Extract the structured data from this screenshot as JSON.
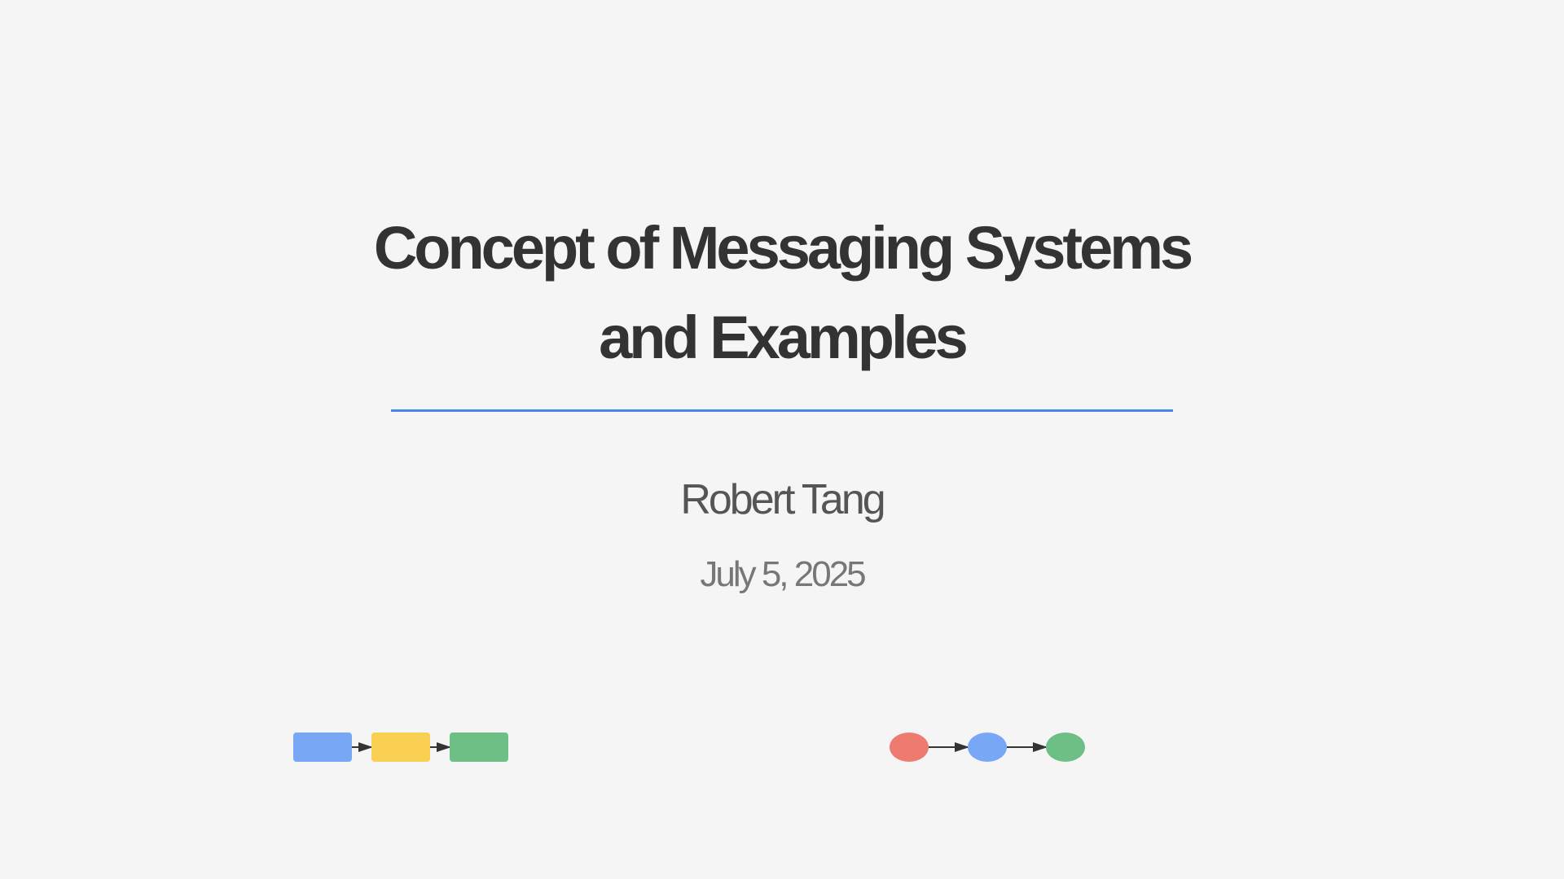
{
  "slide": {
    "title_line1": "Concept of Messaging Systems",
    "title_line2": "and Examples",
    "author": "Robert Tang",
    "date": "July 5, 2025"
  },
  "colors": {
    "background": "#f5f5f5",
    "title": "#333333",
    "divider": "#4a86e8",
    "blue": "#78a8f5",
    "yellow": "#fad053",
    "green": "#6dbf86",
    "red": "#ee7b70"
  },
  "decorations": {
    "left_flow": {
      "shape": "rounded-rectangle",
      "nodes": [
        "blue",
        "yellow",
        "green"
      ]
    },
    "right_flow": {
      "shape": "circle",
      "nodes": [
        "red",
        "blue",
        "green"
      ]
    }
  }
}
